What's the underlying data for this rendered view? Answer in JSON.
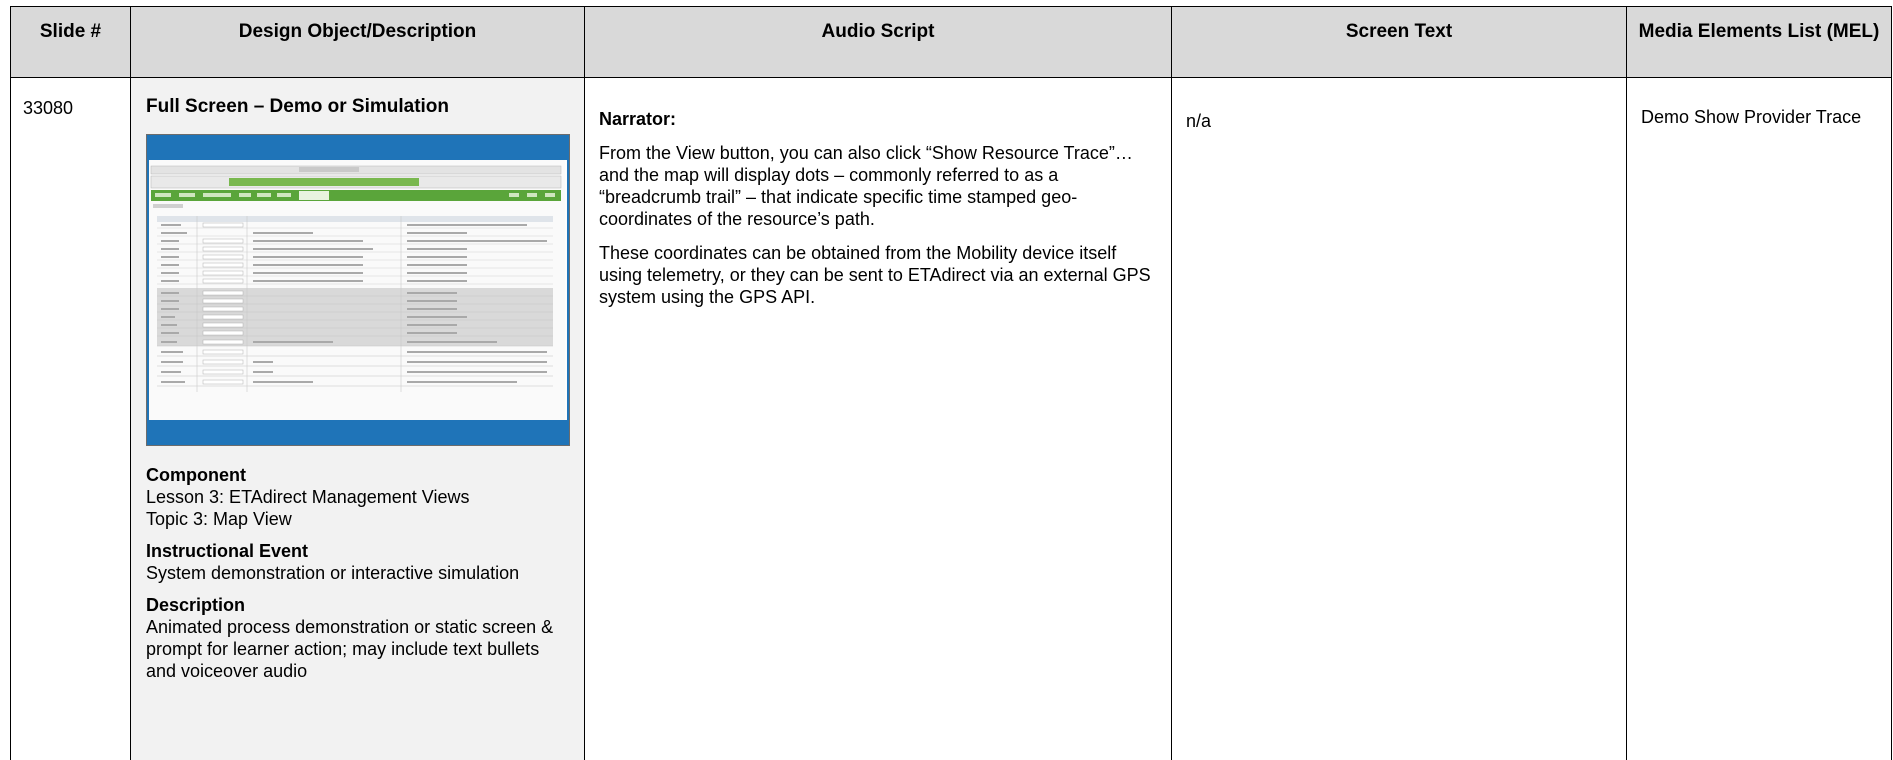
{
  "table": {
    "headers": {
      "slide_num": "Slide #",
      "design": "Design Object/Description",
      "audio": "Audio Script",
      "screen_text": "Screen Text",
      "mel": "Media Elements List (MEL)"
    },
    "row": {
      "slide_num": "33080",
      "design": {
        "title": "Full Screen – Demo or Simulation",
        "component_label": "Component",
        "component_line1": "Lesson 3: ETAdirect Management Views",
        "component_line2": "Topic 3: Map View",
        "instructional_label": "Instructional Event",
        "instructional_body": "System demonstration or interactive simulation",
        "description_label": "Description",
        "description_body": "Animated process demonstration or static screen & prompt for learner action; may include text bullets and voiceover audio"
      },
      "audio": {
        "narrator_label": "Narrator:",
        "para1": "From the View button, you can also click “Show Resource Trace”…  and the map will display dots – commonly referred to as a “breadcrumb trail” – that indicate specific time stamped geo-coordinates of the resource’s path.",
        "para2": "These coordinates can be obtained from the Mobility device itself using telemetry, or they can be sent to ETAdirect via an external GPS system using the GPS API."
      },
      "screen_text": "n/a",
      "mel": "Demo Show Provider Trace"
    }
  },
  "colors": {
    "header_bg": "#d9d9d9",
    "design_cell_bg": "#f2f2f2",
    "thumbnail_frame": "#1f74b8",
    "thumbnail_nav": "#5aa53a"
  }
}
